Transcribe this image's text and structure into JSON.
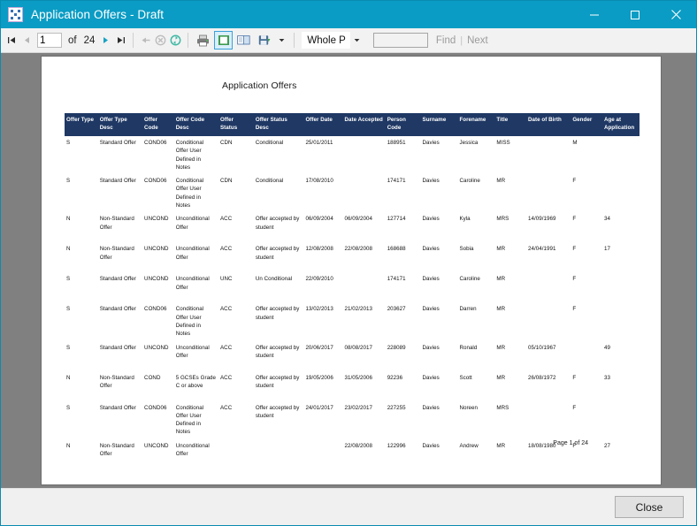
{
  "window": {
    "title": "Application Offers - Draft",
    "app_icon": "app-grid-icon",
    "minimize_label": "─",
    "maximize_label": "□",
    "close_label": "✕",
    "titlebar_color": "#0a9cc4"
  },
  "toolbar": {
    "first_page_icon": "first-page-icon",
    "prev_page_icon": "previous-page-icon",
    "page_number": "1",
    "of_label": "of",
    "total_pages": "24",
    "next_page_icon": "next-page-icon",
    "last_page_icon": "last-page-icon",
    "back_icon": "back-arrow-icon",
    "stop_icon": "stop-icon",
    "refresh_icon": "refresh-icon",
    "print_icon": "print-icon",
    "print_layout_icon": "print-layout-icon",
    "page_setup_icon": "page-setup-icon",
    "export_icon": "export-save-icon",
    "export_dropdown_icon": "chevron-down-icon",
    "zoom_value": "Whole P",
    "zoom_dropdown_icon": "chevron-down-icon",
    "find_value": "",
    "find_label": "Find",
    "next_label": "Next"
  },
  "report": {
    "title": "Application Offers",
    "page_footer": "Page 1 of 24",
    "columns": [
      "Offer Type",
      "Offer Type Desc",
      "Offer Code",
      "Offer Code Desc",
      "Offer Status",
      "Offer Status Desc",
      "Offer Date",
      "Date Accepted",
      "Person Code",
      "Surname",
      "Forename",
      "Title",
      "Date of Birth",
      "Gender",
      "Age at Application"
    ],
    "rows": [
      [
        "S",
        "Standard Offer",
        "COND06",
        "Conditional Offer User Defined in Notes",
        "CDN",
        "Conditional",
        "25/01/2011",
        "",
        "188951",
        "Davies",
        "Jessica",
        "MISS",
        "",
        "M",
        ""
      ],
      [
        "S",
        "Standard Offer",
        "COND06",
        "Conditional Offer User Defined in Notes",
        "CDN",
        "Conditional",
        "17/08/2010",
        "",
        "174171",
        "Davies",
        "Caroline",
        "MR",
        "",
        "F",
        ""
      ],
      [
        "N",
        "Non-Standard Offer",
        "UNCOND",
        "Unconditional Offer",
        "ACC",
        "Offer accepted by student",
        "06/09/2004",
        "06/09/2004",
        "127714",
        "Davies",
        "Kyla",
        "MRS",
        "14/09/1969",
        "F",
        "34"
      ],
      [
        "N",
        "Non-Standard Offer",
        "UNCOND",
        "Unconditional Offer",
        "ACC",
        "Offer accepted by student",
        "12/08/2008",
        "22/08/2008",
        "168688",
        "Davies",
        "Sobia",
        "MR",
        "24/04/1991",
        "F",
        "17"
      ],
      [
        "S",
        "Standard Offer",
        "UNCOND",
        "Unconditional Offer",
        "UNC",
        "Un Conditional",
        "22/09/2010",
        "",
        "174171",
        "Davies",
        "Caroline",
        "MR",
        "",
        "F",
        ""
      ],
      [
        "S",
        "Standard Offer",
        "COND06",
        "Conditional Offer User Defined in Notes",
        "ACC",
        "Offer accepted by student",
        "13/02/2013",
        "21/02/2013",
        "203627",
        "Davies",
        "Darren",
        "MR",
        "",
        "F",
        ""
      ],
      [
        "S",
        "Standard Offer",
        "UNCOND",
        "Unconditional Offer",
        "ACC",
        "Offer accepted by student",
        "20/06/2017",
        "08/08/2017",
        "228089",
        "Davies",
        "Ronald",
        "MR",
        "05/10/1967",
        "",
        "49"
      ],
      [
        "N",
        "Non-Standard Offer",
        "COND",
        "5 GCSEs Grade C or above",
        "ACC",
        "Offer accepted by student",
        "19/05/2006",
        "31/05/2006",
        "92236",
        "Davies",
        "Scott",
        "MR",
        "26/08/1972",
        "F",
        "33"
      ],
      [
        "S",
        "Standard Offer",
        "COND06",
        "Conditional Offer User Defined in Notes",
        "ACC",
        "Offer accepted by student",
        "24/01/2017",
        "23/02/2017",
        "227255",
        "Davies",
        "Noreen",
        "MRS",
        "",
        "F",
        ""
      ],
      [
        "N",
        "Non-Standard Offer",
        "UNCOND",
        "Unconditional Offer",
        "",
        "",
        "",
        "22/08/2008",
        "122996",
        "Davies",
        "Andrew",
        "MR",
        "18/08/1980",
        "F",
        "27"
      ]
    ]
  },
  "footer": {
    "close_label": "Close"
  }
}
